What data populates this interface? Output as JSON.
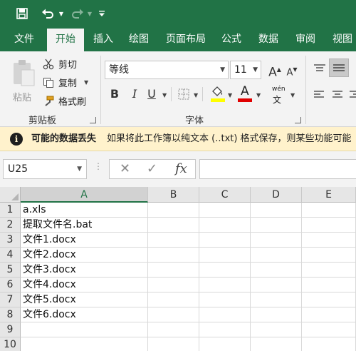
{
  "quick_access": {
    "save_icon": "save-icon",
    "undo_icon": "undo-icon",
    "redo_icon": "redo-icon",
    "customize_icon": "customize-qat-icon"
  },
  "tabs": [
    "文件",
    "开始",
    "插入",
    "绘图",
    "页面布局",
    "公式",
    "数据",
    "审阅",
    "视图"
  ],
  "active_tab": "开始",
  "ribbon": {
    "clipboard": {
      "paste_label": "粘贴",
      "cut_label": "剪切",
      "copy_label": "复制",
      "format_painter_label": "格式刷",
      "group_label": "剪贴板"
    },
    "font": {
      "font_name": "等线",
      "font_size": "11",
      "grow_label": "A",
      "shrink_label": "A",
      "bold_label": "B",
      "italic_label": "I",
      "underline_label": "U",
      "font_color_label": "A",
      "phonetic_label": "wén",
      "group_label": "字体",
      "fill_color": "#ffff00",
      "font_color": "#e00000"
    }
  },
  "infobar": {
    "title": "可能的数据丢失",
    "message": "如果将此工作簿以纯文本 (..txt) 格式保存，则某些功能可能"
  },
  "formula_bar": {
    "name_box": "U25",
    "fx_label": "fx",
    "cancel_label": "✕",
    "enter_label": "✓"
  },
  "grid": {
    "columns": [
      "A",
      "B",
      "C",
      "D",
      "E"
    ],
    "selected_column": "A",
    "rows": [
      {
        "num": "1",
        "a": "a.xls"
      },
      {
        "num": "2",
        "a": "提取文件名.bat"
      },
      {
        "num": "3",
        "a": "文件1.docx"
      },
      {
        "num": "4",
        "a": "文件2.docx"
      },
      {
        "num": "5",
        "a": "文件3.docx"
      },
      {
        "num": "6",
        "a": "文件4.docx"
      },
      {
        "num": "7",
        "a": "文件5.docx"
      },
      {
        "num": "8",
        "a": "文件6.docx"
      },
      {
        "num": "9",
        "a": ""
      },
      {
        "num": "10",
        "a": ""
      }
    ]
  },
  "colors": {
    "brand": "#217346",
    "infobar_bg": "#fff2cc"
  }
}
